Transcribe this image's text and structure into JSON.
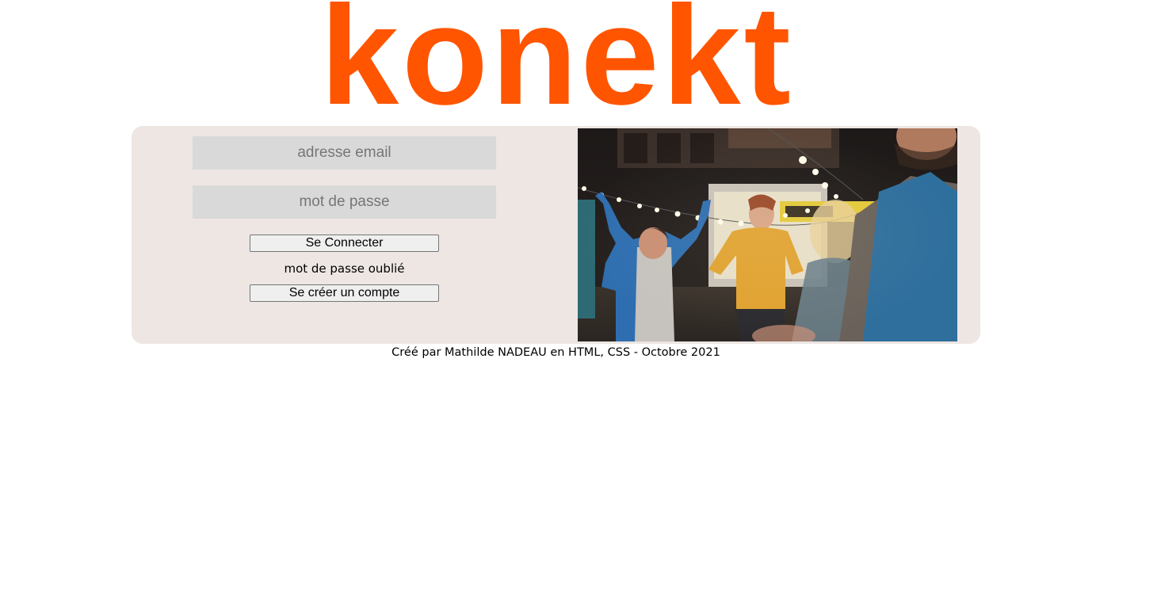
{
  "brand": {
    "logo_text": "konekt",
    "color": "#ff5500"
  },
  "login_form": {
    "email_placeholder": "adresse email",
    "password_placeholder": "mot de passe",
    "connect_label": "Se Connecter",
    "forgot_label": "mot de passe oublié",
    "create_account_label": "Se créer un compte"
  },
  "photo": {
    "description_icon": "photo-of-people-dancing-under-string-lights"
  },
  "footer": {
    "text": "Créé par Mathilde NADEAU en HTML, CSS - Octobre 2021"
  },
  "colors": {
    "card_background": "#ede6e3",
    "field_background": "#d9d9d9"
  }
}
